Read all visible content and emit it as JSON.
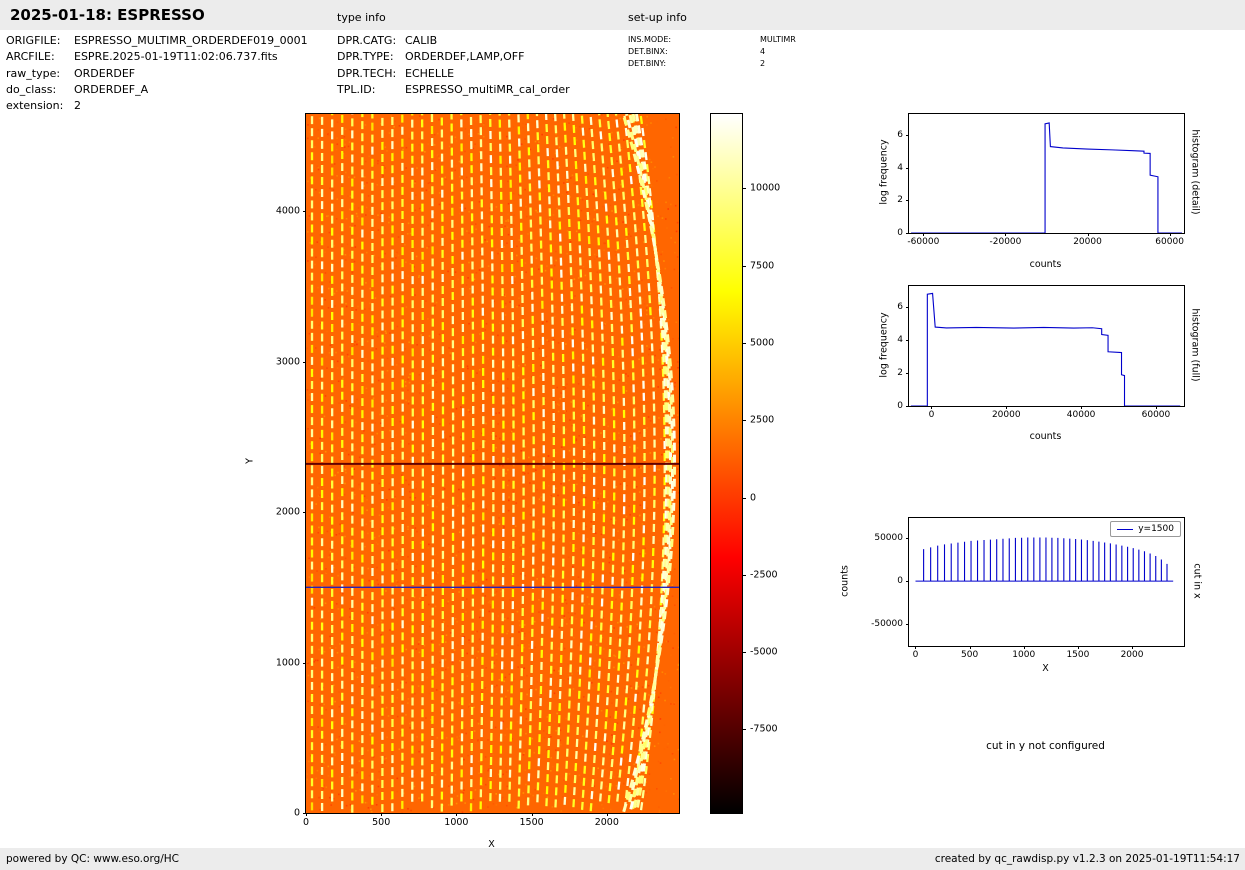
{
  "header": {
    "title": "2025-01-18: ESPRESSO",
    "type_info_label": "type info",
    "setup_info_label": "set-up info"
  },
  "file_info": {
    "rows": [
      {
        "label": "ORIGFILE:",
        "value": "ESPRESSO_MULTIMR_ORDERDEF019_0001"
      },
      {
        "label": "ARCFILE:",
        "value": "ESPRE.2025-01-19T11:02:06.737.fits"
      },
      {
        "label": "raw_type:",
        "value": "ORDERDEF"
      },
      {
        "label": "do_class:",
        "value": "ORDERDEF_A"
      },
      {
        "label": "extension:",
        "value": "2"
      }
    ]
  },
  "type_info": {
    "rows": [
      {
        "label": "DPR.CATG:",
        "value": "CALIB"
      },
      {
        "label": "DPR.TYPE:",
        "value": "ORDERDEF,LAMP,OFF"
      },
      {
        "label": "DPR.TECH:",
        "value": "ECHELLE"
      },
      {
        "label": "TPL.ID:",
        "value": "ESPRESSO_multiMR_cal_order"
      }
    ]
  },
  "setup_info": {
    "rows": [
      {
        "label": "INS.MODE:",
        "value": "MULTIMR"
      },
      {
        "label": "DET.BINX:",
        "value": "4"
      },
      {
        "label": "DET.BINY:",
        "value": "2"
      }
    ]
  },
  "notes": {
    "cut_in_y": "cut in y not configured"
  },
  "footer": {
    "left": "powered by QC: www.eso.org/HC",
    "right": "created by qc_rawdisp.py v1.2.3 on 2025-01-19T11:54:17"
  },
  "chart_data": [
    {
      "id": "raw_image",
      "type": "heatmap",
      "description": "ESPRESSO ORDERDEF raw frame: bright dashed vertical echelle orders on orange background, orders curve and merge at right edge",
      "xlabel": "X",
      "ylabel": "Y",
      "xlim": [
        0,
        2480
      ],
      "ylim": [
        0,
        4645
      ],
      "xticks": [
        0,
        500,
        1000,
        1500,
        2000
      ],
      "yticks": [
        0,
        1000,
        2000,
        3000,
        4000
      ],
      "colormap": "hot",
      "clim": [
        -10200,
        12400
      ],
      "colorbar_ticks": [
        10000,
        7500,
        5000,
        2500,
        0,
        -2500,
        -5000,
        -7500
      ],
      "background_value": 1500,
      "n_orders": 36,
      "order_x_start": 40,
      "order_spacing": 67,
      "order_value_range": [
        5500,
        11500
      ],
      "order_curvature_max": 160,
      "detector_gap_y": 2320,
      "cut_line_y": 1500,
      "cut_line_color": "#2222bb"
    },
    {
      "id": "histogram_detail",
      "type": "line",
      "xlabel": "counts",
      "ylabel": "log frequency",
      "right_label": "histogram (detail)",
      "color": "#0000cc",
      "xlim": [
        -67000,
        67000
      ],
      "ylim": [
        0,
        7.3
      ],
      "xticks": [
        -60000,
        -20000,
        20000,
        60000
      ],
      "yticks": [
        0,
        2,
        4,
        6
      ],
      "x": [
        -66000,
        -700,
        -700,
        1300,
        1900,
        8000,
        20000,
        32000,
        42000,
        47500,
        47500,
        50500,
        50500,
        54300,
        54300,
        66000
      ],
      "y": [
        0,
        0,
        6.7,
        6.75,
        5.3,
        5.22,
        5.15,
        5.1,
        5.05,
        5.02,
        4.9,
        4.88,
        3.55,
        3.45,
        0,
        0
      ]
    },
    {
      "id": "histogram_full",
      "type": "line",
      "xlabel": "counts",
      "ylabel": "log frequency",
      "right_label": "histogram (full)",
      "color": "#0000cc",
      "xlim": [
        -6000,
        67500
      ],
      "ylim": [
        0,
        7.3
      ],
      "xticks": [
        0,
        20000,
        40000,
        60000
      ],
      "yticks": [
        0,
        2,
        4,
        6
      ],
      "x": [
        -5500,
        -1100,
        -1100,
        300,
        1000,
        4000,
        12000,
        22000,
        30000,
        38000,
        43000,
        45500,
        45500,
        47200,
        47200,
        50800,
        50800,
        51600,
        51600,
        66500
      ],
      "y": [
        0,
        0,
        6.8,
        6.85,
        4.8,
        4.75,
        4.78,
        4.74,
        4.78,
        4.74,
        4.76,
        4.7,
        4.35,
        4.3,
        3.3,
        3.25,
        1.9,
        1.85,
        0,
        0
      ]
    },
    {
      "id": "cut_in_x",
      "type": "line",
      "xlabel": "X",
      "ylabel": "counts",
      "right_label": "cut in x",
      "color": "#0000cc",
      "legend": [
        {
          "name": "y=1500",
          "color": "#0000cc"
        }
      ],
      "xlim": [
        -60,
        2480
      ],
      "ylim": [
        -75000,
        73000
      ],
      "xticks": [
        0,
        500,
        1000,
        1500,
        2000
      ],
      "yticks": [
        -50000,
        0,
        50000
      ],
      "baseline": 0,
      "spike_x": [
        75,
        140,
        205,
        268,
        330,
        392,
        453,
        513,
        573,
        633,
        692,
        750,
        808,
        866,
        923,
        980,
        1037,
        1093,
        1149,
        1205,
        1260,
        1315,
        1370,
        1425,
        1479,
        1533,
        1587,
        1641,
        1694,
        1747,
        1800,
        1853,
        1906,
        1959,
        2011,
        2063,
        2115,
        2167,
        2219,
        2271,
        2323
      ],
      "spike_h": [
        37000,
        39000,
        41000,
        42500,
        43500,
        44500,
        45500,
        46500,
        47000,
        47500,
        48000,
        48500,
        49000,
        49500,
        50000,
        50200,
        50400,
        50500,
        50500,
        50400,
        50200,
        50000,
        49600,
        49200,
        48700,
        48100,
        47400,
        46600,
        45700,
        44700,
        43600,
        42400,
        41100,
        39700,
        38200,
        36500,
        34500,
        32000,
        29000,
        25000,
        20000
      ]
    }
  ]
}
